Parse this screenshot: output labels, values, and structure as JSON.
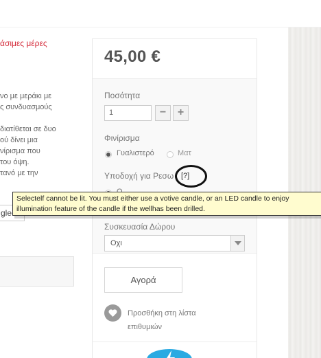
{
  "page": {
    "delivery_text": "άσιμες μέρες",
    "description_lines_1": [
      "νο με μεράκι με",
      "ς συνδυασμούς"
    ],
    "description_lines_2": [
      "διατίθεται σε δυο",
      "ού δίνει μια",
      "νίρισμα που",
      "του όψη.",
      "τανό με την"
    ],
    "lang_partial": "gle-"
  },
  "product": {
    "price": "45,00 €",
    "quantity_label": "Ποσότητα",
    "quantity_value": "1",
    "minus_label": "−",
    "plus_label": "+",
    "finish_label": "Φινίρισμα",
    "finish_options": [
      "Γυαλιστερό",
      "Ματ"
    ],
    "finish_selected": "Γυαλιστερό",
    "holder_label": "Υποδοχή για Ρεσω",
    "help_link": "[?]",
    "holder_option_partial": "O",
    "gift_label": "Συσκευασία Δώρου",
    "gift_value": "Οχι",
    "buy_label": "Αγορά",
    "wishlist_label": "Προσθήκη στη λίστα επιθυμιών"
  },
  "tooltip": {
    "line1": "Selectelf cannot be lit. You must either use a votive candle, or an LED candle to enjoy",
    "line2": "illumination feature of the candle if the wellhas been drilled."
  },
  "icons": {
    "wishlist": "heart-icon",
    "brand": "brand-icon",
    "select_arrow": "caret-down-icon"
  },
  "colors": {
    "delivery_red": "#d42b3a",
    "tooltip_bg": "#fffccf",
    "brand_blue": "#2aaae2",
    "wishlist_gray": "#9a9a9a"
  }
}
